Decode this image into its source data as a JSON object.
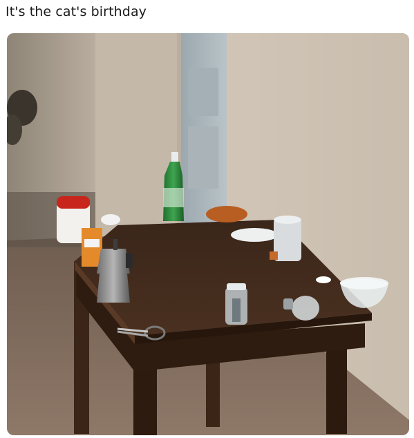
{
  "post": {
    "caption": "It's the cat's birthday"
  },
  "photo": {
    "subject": "photo-of-cluttered-table",
    "colors": {
      "wall": "#d8cdbf",
      "floor": "#8b7564",
      "table": "#3b2518",
      "bottle": "#2f8a3c",
      "cap_red": "#c8251c"
    }
  }
}
